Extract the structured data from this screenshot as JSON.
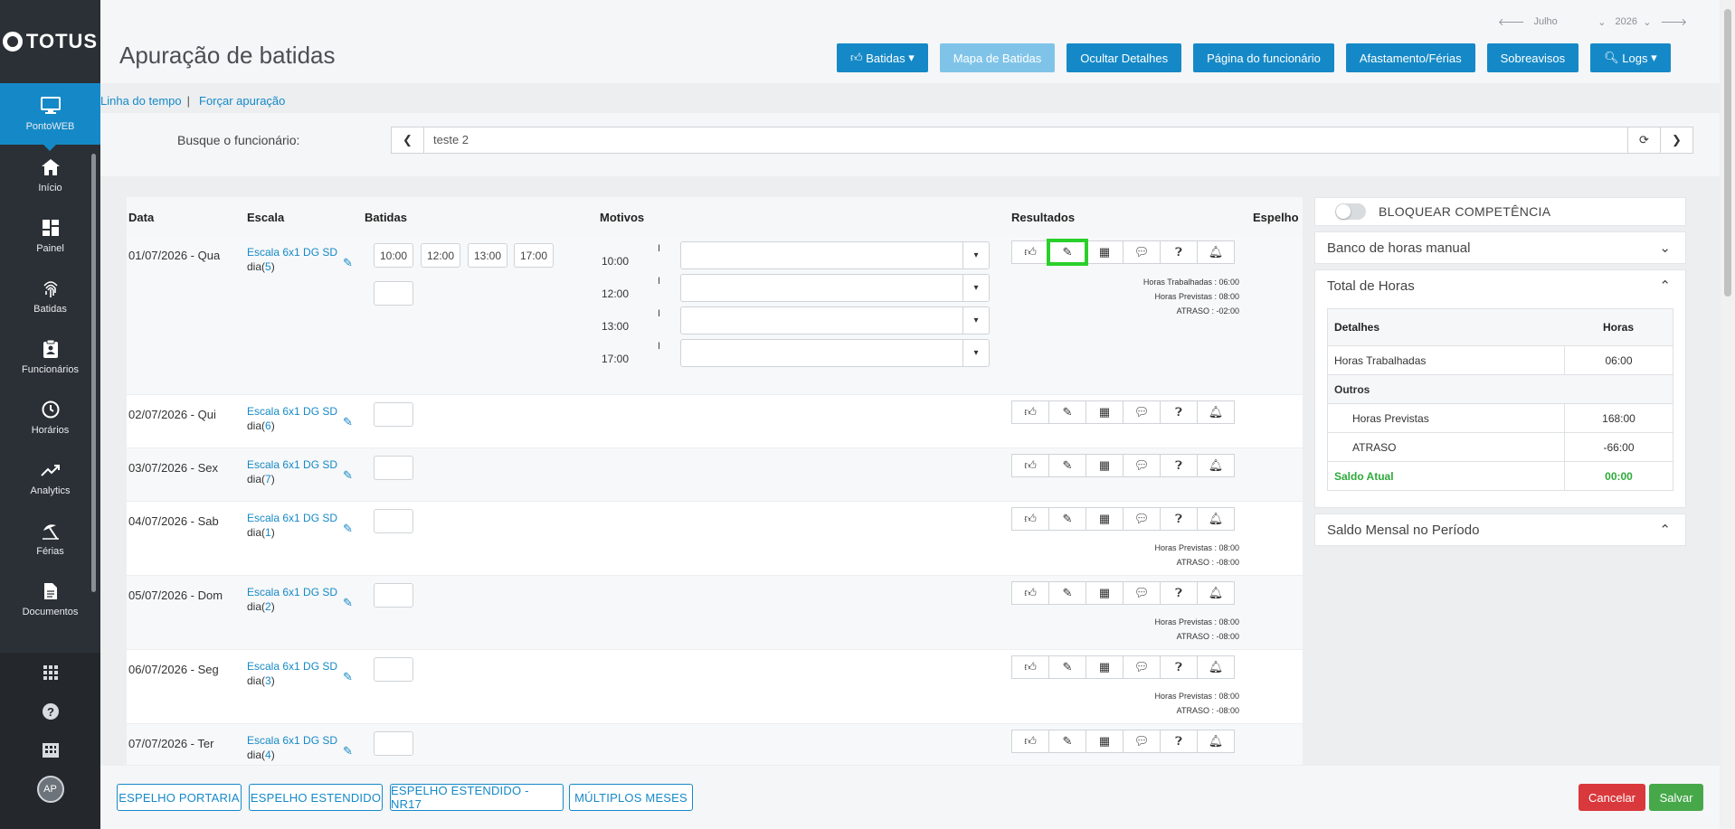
{
  "sidebar": {
    "logo": "TOTUS",
    "items": [
      {
        "label": "PontoWEB",
        "icon": "monitor-icon"
      },
      {
        "label": "Início",
        "icon": "home-icon"
      },
      {
        "label": "Painel",
        "icon": "dashboard-icon"
      },
      {
        "label": "Batidas",
        "icon": "fingerprint-icon"
      },
      {
        "label": "Funcionários",
        "icon": "clipboard-user-icon"
      },
      {
        "label": "Horários",
        "icon": "clock-icon"
      },
      {
        "label": "Analytics",
        "icon": "trend-icon"
      },
      {
        "label": "Férias",
        "icon": "beach-umbrella-icon"
      },
      {
        "label": "Documentos",
        "icon": "document-icon"
      }
    ],
    "avatar": "AP"
  },
  "header": {
    "title": "Apuração de batidas",
    "month": "Julho",
    "year": "2026",
    "buttons": {
      "batidas": "Batidas",
      "mapa": "Mapa de Batidas",
      "ocultar": "Ocultar Detalhes",
      "pagina": "Página do funcionário",
      "afastamento": "Afastamento/Férias",
      "sobreavisos": "Sobreavisos",
      "logs": "Logs"
    }
  },
  "links": {
    "linha": "Linha do tempo",
    "sep": "|",
    "forcar": "Forçar apuração"
  },
  "search": {
    "label": "Busque o funcionário:",
    "value": "teste 2"
  },
  "table": {
    "headers": {
      "data": "Data",
      "escala": "Escala",
      "batidas": "Batidas",
      "motivos": "Motivos",
      "resultados": "Resultados",
      "espelho": "Espelho"
    },
    "rows": [
      {
        "date": "01/07/2026 - Qua",
        "escala": "Escala 6x1 DG SD",
        "dia_prefix": "dia(",
        "dia": "5",
        "dia_suffix": ")",
        "batidas": [
          "10:00",
          "12:00",
          "13:00",
          "17:00"
        ],
        "motivos": [
          "10:00",
          "12:00",
          "13:00",
          "17:00"
        ],
        "results": [
          "Horas Trabalhadas : 06:00",
          "Horas Previstas : 08:00",
          "ATRASO : -02:00"
        ]
      },
      {
        "date": "02/07/2026 - Qui",
        "escala": "Escala 6x1 DG SD",
        "dia_prefix": "dia(",
        "dia": "6",
        "dia_suffix": ")",
        "results": []
      },
      {
        "date": "03/07/2026 - Sex",
        "escala": "Escala 6x1 DG SD",
        "dia_prefix": "dia(",
        "dia": "7",
        "dia_suffix": ")",
        "results": []
      },
      {
        "date": "04/07/2026 - Sab",
        "escala": "Escala 6x1 DG SD",
        "dia_prefix": "dia(",
        "dia": "1",
        "dia_suffix": ")",
        "results": [
          "Horas Previstas : 08:00",
          "ATRASO : -08:00"
        ]
      },
      {
        "date": "05/07/2026 - Dom",
        "escala": "Escala 6x1 DG SD",
        "dia_prefix": "dia(",
        "dia": "2",
        "dia_suffix": ")",
        "results": [
          "Horas Previstas : 08:00",
          "ATRASO : -08:00"
        ]
      },
      {
        "date": "06/07/2026 - Seg",
        "escala": "Escala 6x1 DG SD",
        "dia_prefix": "dia(",
        "dia": "3",
        "dia_suffix": ")",
        "results": [
          "Horas Previstas : 08:00",
          "ATRASO : -08:00"
        ]
      },
      {
        "date": "07/07/2026 - Ter",
        "escala": "Escala 6x1 DG SD",
        "dia_prefix": "dia(",
        "dia": "4",
        "dia_suffix": ")",
        "results": []
      }
    ]
  },
  "right": {
    "bloquear": "BLOQUEAR COMPETÊNCIA",
    "banco": "Banco de horas manual",
    "total": "Total de Horas",
    "det_header": "Detalhes",
    "horas_header": "Horas",
    "trabalhadas": "Horas Trabalhadas",
    "trabalhadas_val": "06:00",
    "outros": "Outros",
    "previstas": "Horas Previstas",
    "previstas_val": "168:00",
    "atraso": "ATRASO",
    "atraso_val": "-66:00",
    "saldo": "Saldo Atual",
    "saldo_val": "00:00",
    "saldo_mensal": "Saldo Mensal no Período"
  },
  "footer": {
    "portaria": "ESPELHO PORTARIA",
    "estendido": "ESPELHO ESTENDIDO",
    "nr17": "ESPELHO ESTENDIDO - NR17",
    "multiplos": "MÚLTIPLOS MESES",
    "cancelar": "Cancelar",
    "salvar": "Salvar"
  },
  "colors": {
    "primary": "#1589c7",
    "cancel": "#d9383c",
    "save": "#47a84a",
    "highlight": "#2ad02a",
    "saldo": "#2eaa3a"
  }
}
